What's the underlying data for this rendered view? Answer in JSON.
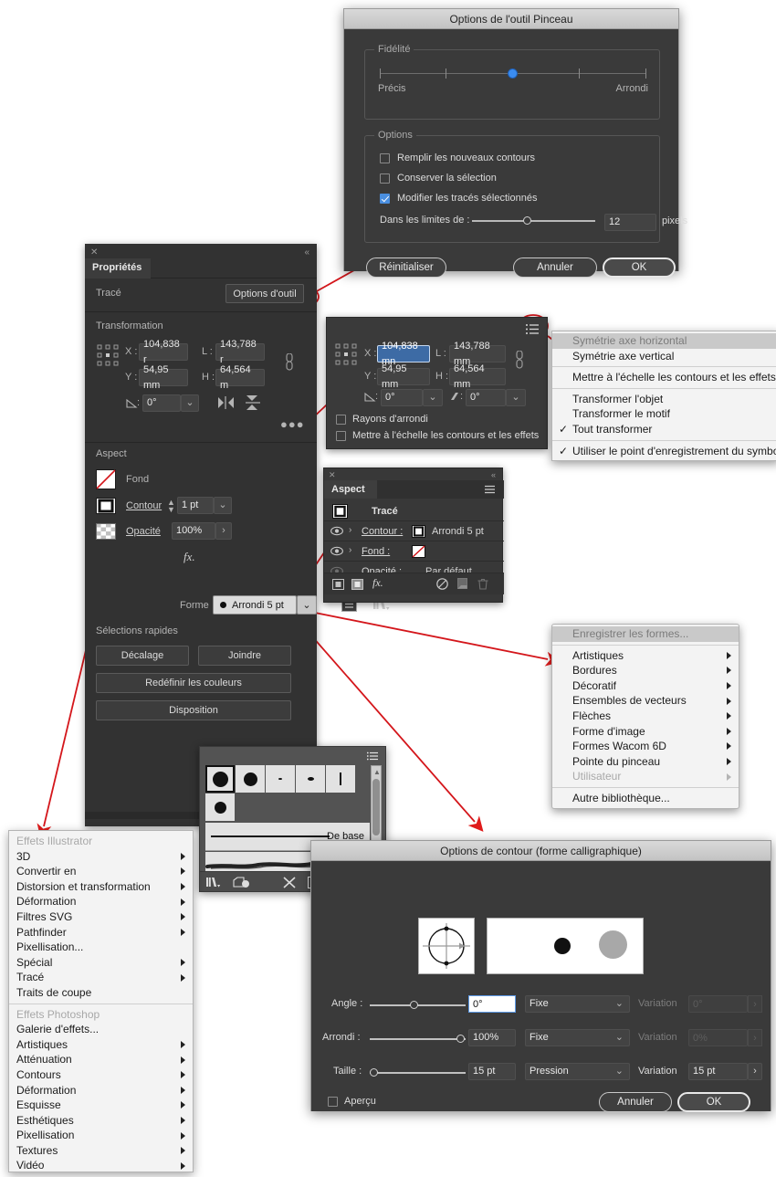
{
  "brush_tool_dialog": {
    "title": "Options de l'outil Pinceau",
    "fidelity_group": "Fidélité",
    "fidelity_left": "Précis",
    "fidelity_right": "Arrondi",
    "options_group": "Options",
    "checkboxes": [
      {
        "label": "Remplir les nouveaux contours",
        "checked": false
      },
      {
        "label": "Conserver la sélection",
        "checked": false
      },
      {
        "label": "Modifier les tracés sélectionnés",
        "checked": true
      }
    ],
    "limit_label": "Dans les limites de :",
    "limit_value": "12",
    "limit_unit": "pixels",
    "reset_label": "Réinitialiser",
    "cancel_label": "Annuler",
    "ok_label": "OK"
  },
  "properties_panel": {
    "close_icon": "close-icon",
    "collapse_icon": "collapse-icon",
    "tab_label": "Propriétés",
    "path_label": "Tracé",
    "tool_options_button": "Options d'outil",
    "transform_section": "Transformation",
    "x_label": "X :",
    "x_value": "104,838 r",
    "w_label": "L :",
    "w_value": "143,788 r",
    "y_label": "Y :",
    "y_value": "54,95 mm",
    "h_label": "H :",
    "h_value": "64,564 m",
    "angle_value": "0°",
    "more_icon": "ellipsis-icon",
    "aspect_section": "Aspect",
    "fill_label": "Fond",
    "stroke_label": "Contour",
    "stroke_value": "1 pt",
    "opacity_label": "Opacité",
    "opacity_value": "100%",
    "fx_label": "fx.",
    "brush_label": "Forme",
    "brush_value": "Arrondi 5 pt",
    "quick_section": "Sélections rapides",
    "quick_buttons": [
      "Décalage",
      "Joindre",
      "Redéfinir les couleurs",
      "Disposition"
    ]
  },
  "transform_panel": {
    "menu_icon": "panel-menu-icon",
    "x_label": "X :",
    "x_value": "104,838 mn",
    "w_label": "L :",
    "w_value": "143,788 mm",
    "y_label": "Y :",
    "y_value": "54,95 mm",
    "h_label": "H :",
    "h_value": "64,564 mm",
    "angle_value": "0°",
    "shear_value": "0°",
    "link_icon": "link-broken-icon",
    "checkboxes": [
      {
        "label": "Rayons d'arrondi",
        "checked": false
      },
      {
        "label": "Mettre à l'échelle les contours et les effets",
        "checked": false
      }
    ]
  },
  "transform_flyout": {
    "items": [
      {
        "label": "Symétrie axe horizontal",
        "highlighted": true,
        "check": false,
        "sep_after": false
      },
      {
        "label": "Symétrie axe vertical",
        "highlighted": false,
        "check": false,
        "sep_after": true
      },
      {
        "label": "Mettre à l'échelle les contours et les effets",
        "highlighted": false,
        "check": false,
        "sep_after": true
      },
      {
        "label": "Transformer l'objet",
        "highlighted": false,
        "check": false,
        "sep_after": false
      },
      {
        "label": "Transformer le motif",
        "highlighted": false,
        "check": false,
        "sep_after": false
      },
      {
        "label": "Tout transformer",
        "highlighted": false,
        "check": true,
        "sep_after": true
      },
      {
        "label": "Utiliser le point d'enregistrement du symbole",
        "highlighted": false,
        "check": true,
        "sep_after": false
      }
    ]
  },
  "aspect_panel": {
    "close_icon": "close-icon",
    "collapse_icon": "collapse-icon",
    "tab_label": "Aspect",
    "menu_icon": "panel-menu-icon",
    "path_row": "Tracé",
    "rows": [
      {
        "label": "Contour :",
        "value": "Arrondi 5 pt"
      },
      {
        "label": "Fond :",
        "value": ""
      },
      {
        "label": "Opacité :",
        "value": "Par défaut"
      }
    ],
    "footer_icons": [
      "add-new-stroke-icon",
      "add-new-fill-icon",
      "fx-icon",
      "clear-appearance-icon",
      "duplicate-item-icon",
      "delete-item-icon"
    ],
    "fx_label": "fx."
  },
  "brush_library_menu": {
    "header": "Enregistrer les formes...",
    "items": [
      {
        "label": "Artistiques",
        "submenu": true,
        "disabled": false
      },
      {
        "label": "Bordures",
        "submenu": true,
        "disabled": false
      },
      {
        "label": "Décoratif",
        "submenu": true,
        "disabled": false
      },
      {
        "label": "Ensembles de vecteurs",
        "submenu": true,
        "disabled": false
      },
      {
        "label": "Flèches",
        "submenu": true,
        "disabled": false
      },
      {
        "label": "Forme d'image",
        "submenu": true,
        "disabled": false
      },
      {
        "label": "Formes Wacom 6D",
        "submenu": true,
        "disabled": false
      },
      {
        "label": "Pointe du pinceau",
        "submenu": true,
        "disabled": false
      },
      {
        "label": "Utilisateur",
        "submenu": true,
        "disabled": true
      }
    ],
    "footer": "Autre bibliothèque..."
  },
  "brushes_panel": {
    "menu_icon": "panel-menu-icon",
    "swatch_row1": [
      "round-dot-large",
      "round-dot-medium",
      "tiny-speck",
      "small-speck",
      "thin-line"
    ],
    "swatch_row2": [
      "round-dot-small"
    ],
    "art_brush_label": "De base",
    "footer_icons": [
      "brush-libraries-icon",
      "libraries-icon",
      "remove-brush-stroke-icon",
      "options-icon",
      "new-brush-icon",
      "delete-brush-icon"
    ]
  },
  "effects_menu": {
    "section1_title": "Effets Illustrator",
    "section1": [
      {
        "label": "3D",
        "submenu": true
      },
      {
        "label": "Convertir en",
        "submenu": true
      },
      {
        "label": "Distorsion et transformation",
        "submenu": true
      },
      {
        "label": "Déformation",
        "submenu": true
      },
      {
        "label": "Filtres SVG",
        "submenu": true
      },
      {
        "label": "Pathfinder",
        "submenu": true
      },
      {
        "label": "Pixellisation...",
        "submenu": false
      },
      {
        "label": "Spécial",
        "submenu": true
      },
      {
        "label": "Tracé",
        "submenu": true
      },
      {
        "label": "Traits de coupe",
        "submenu": false
      }
    ],
    "section2_title": "Effets Photoshop",
    "section2": [
      {
        "label": "Galerie d'effets...",
        "submenu": false
      },
      {
        "label": "Artistiques",
        "submenu": true
      },
      {
        "label": "Atténuation",
        "submenu": true
      },
      {
        "label": "Contours",
        "submenu": true
      },
      {
        "label": "Déformation",
        "submenu": true
      },
      {
        "label": "Esquisse",
        "submenu": true
      },
      {
        "label": "Esthétiques",
        "submenu": true
      },
      {
        "label": "Pixellisation",
        "submenu": true
      },
      {
        "label": "Textures",
        "submenu": true
      },
      {
        "label": "Vidéo",
        "submenu": true
      }
    ]
  },
  "stroke_options_dialog": {
    "title": "Options de contour (forme calligraphique)",
    "angle_label": "Angle :",
    "angle_value": "0°",
    "angle_mode": "Fixe",
    "angle_variation_label": "Variation",
    "angle_variation_value": "0°",
    "round_label": "Arrondi :",
    "round_value": "100%",
    "round_mode": "Fixe",
    "round_variation_label": "Variation",
    "round_variation_value": "0%",
    "size_label": "Taille :",
    "size_value": "15 pt",
    "size_mode": "Pression",
    "size_variation_label": "Variation",
    "size_variation_value": "15 pt",
    "preview_label": "Aperçu",
    "preview_checked": false,
    "cancel_label": "Annuler",
    "ok_label": "OK"
  },
  "colors": {
    "panel_bg": "#323232",
    "dialog_bg": "#3a3a3a",
    "field_bg": "#434343",
    "accent_blue": "#3a8cf0",
    "selection_blue": "#3d6ba5",
    "annotation_red": "#e01b1b",
    "menu_bg": "#f3f3f3"
  }
}
